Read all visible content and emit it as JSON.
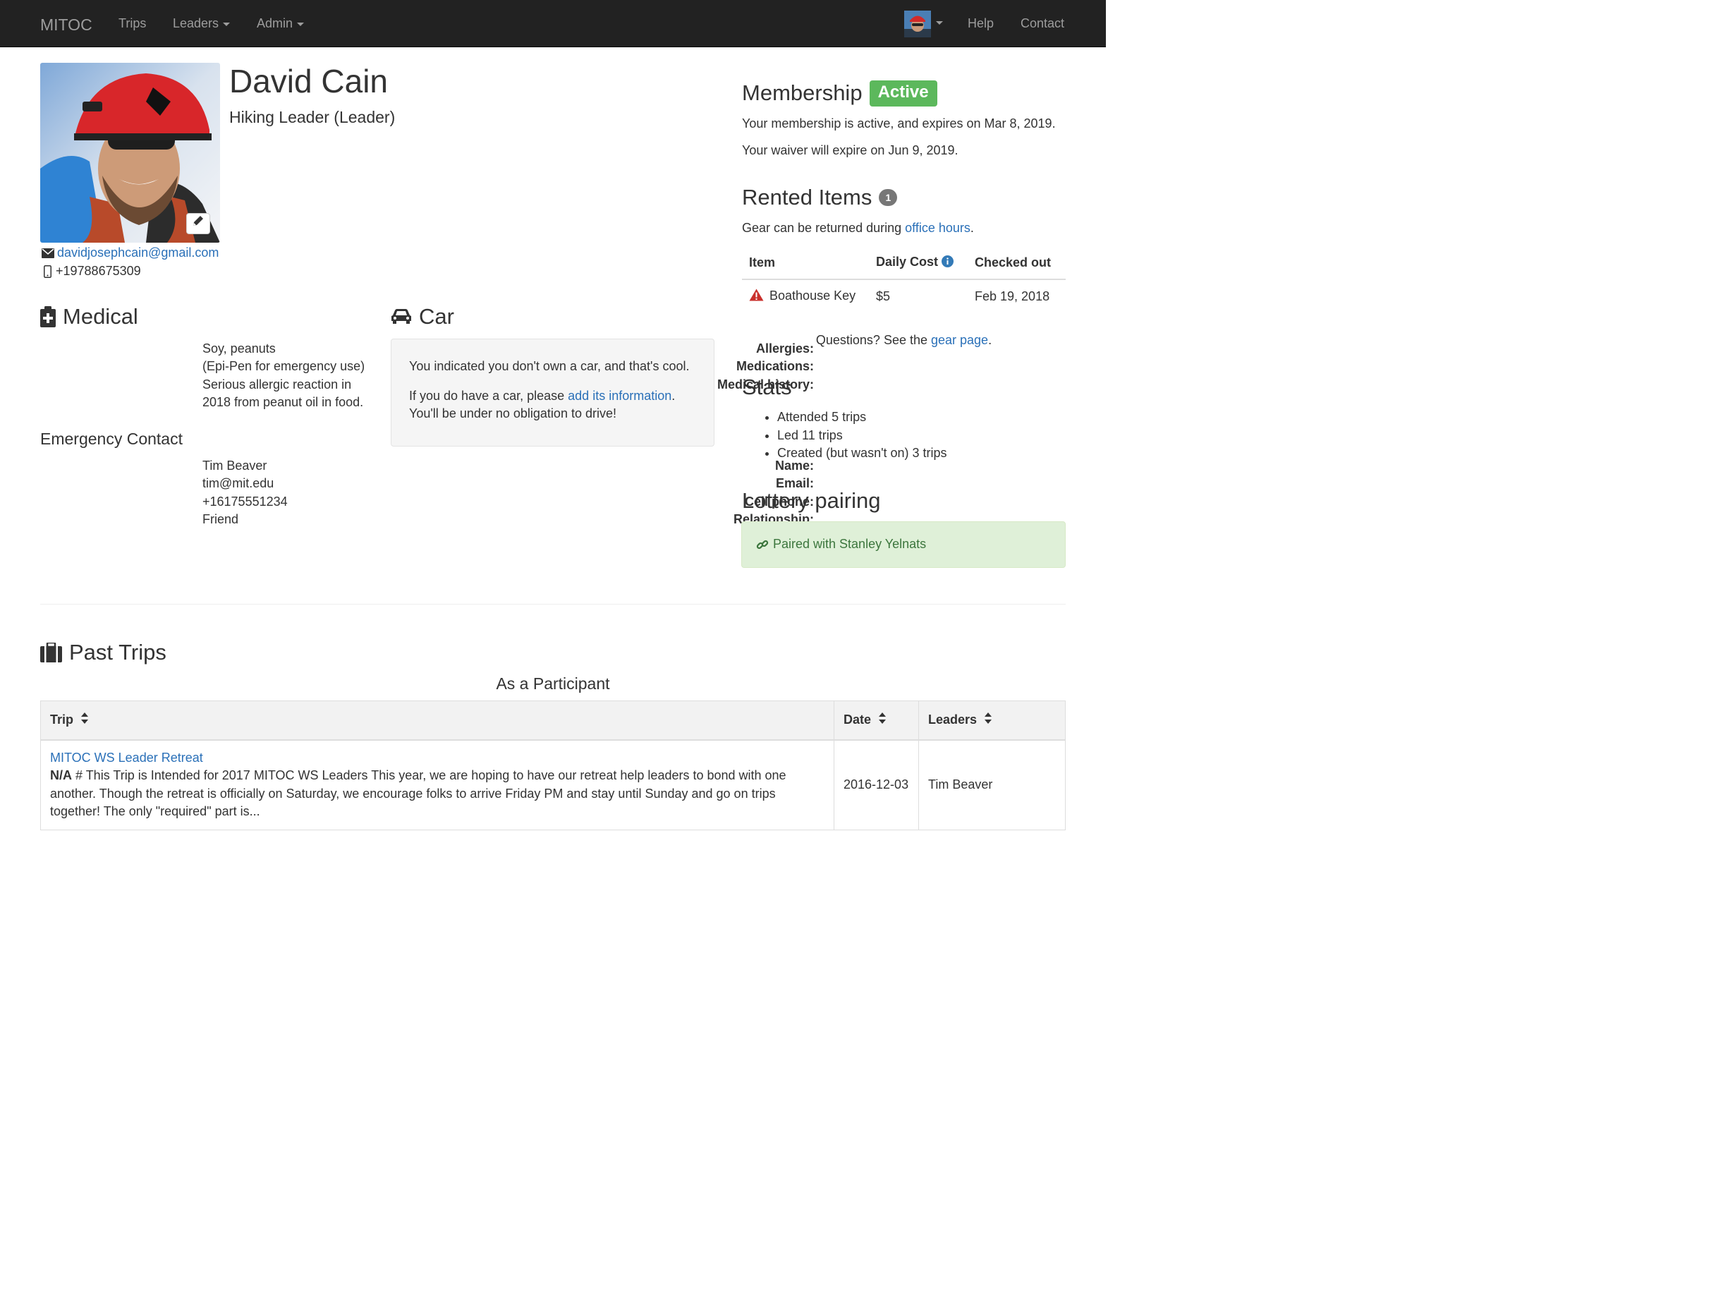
{
  "navbar": {
    "brand": "MITOC",
    "links": {
      "trips": "Trips",
      "leaders": "Leaders",
      "admin": "Admin",
      "help": "Help",
      "contact": "Contact"
    }
  },
  "profile": {
    "name": "David Cain",
    "role": "Hiking Leader (Leader)",
    "email": "davidjosephcain@gmail.com",
    "phone": "+19788675309"
  },
  "medical": {
    "title": "Medical",
    "rows": [
      {
        "label": "Allergies:",
        "value": "Soy, peanuts"
      },
      {
        "label": "Medications:",
        "value": "(Epi-Pen for emergency use)"
      },
      {
        "label": "Medical history:",
        "value_lines": [
          "Serious allergic reaction in",
          "2018 from peanut oil in food."
        ]
      }
    ]
  },
  "emergency": {
    "title": "Emergency Contact",
    "rows": [
      {
        "label": "Name:",
        "value": "Tim Beaver"
      },
      {
        "label": "Email:",
        "value": "tim@mit.edu"
      },
      {
        "label": "Cell phone:",
        "value": "+16175551234"
      },
      {
        "label": "Relationship:",
        "value": "Friend"
      }
    ]
  },
  "car": {
    "title": "Car",
    "line1": "You indicated you don't own a car, and that's cool.",
    "line2_prefix": "If you do have a car, please ",
    "line2_link": "add its information",
    "line2_suffix": ".",
    "line3": "You'll be under no obligation to drive!"
  },
  "membership": {
    "title": "Membership",
    "status": "Active",
    "status_color": "#5cb85c",
    "expires_text": "Your membership is active, and expires on Mar 8, 2019.",
    "waiver_text": "Your waiver will expire on Jun 9, 2019."
  },
  "rented": {
    "title": "Rented Items",
    "count": "1",
    "return_prefix": "Gear can be returned during ",
    "return_link": "office hours",
    "return_suffix": ".",
    "columns": {
      "item": "Item",
      "cost": "Daily Cost",
      "checked_out": "Checked out"
    },
    "rows": [
      {
        "item": "Boathouse Key",
        "cost": "$5",
        "checked_out": "Feb 19, 2018"
      }
    ],
    "questions_prefix": "Questions? See the ",
    "questions_link": "gear page",
    "questions_suffix": "."
  },
  "stats": {
    "title": "Stats",
    "items": [
      "Attended 5 trips",
      "Led 11 trips",
      "Created (but wasn't on) 3 trips"
    ]
  },
  "lottery": {
    "title": "Lottery pairing",
    "text": "Paired with Stanley Yelnats"
  },
  "past_trips": {
    "title": "Past Trips",
    "subtitle": "As a Participant",
    "columns": {
      "trip": "Trip",
      "date": "Date",
      "leaders": "Leaders"
    },
    "rows": [
      {
        "name": "MITOC WS Leader Retreat",
        "desc_prefix": "N/A",
        "desc": " # This Trip is Intended for 2017 MITOC WS Leaders This year, we are hoping to have our retreat help leaders to bond with one another. Though the retreat is officially on Saturday, we encourage folks to arrive Friday PM and stay until Sunday and go on trips together! The only \"required\" part is...",
        "date": "2016-12-03",
        "leaders": "Tim Beaver"
      }
    ]
  }
}
